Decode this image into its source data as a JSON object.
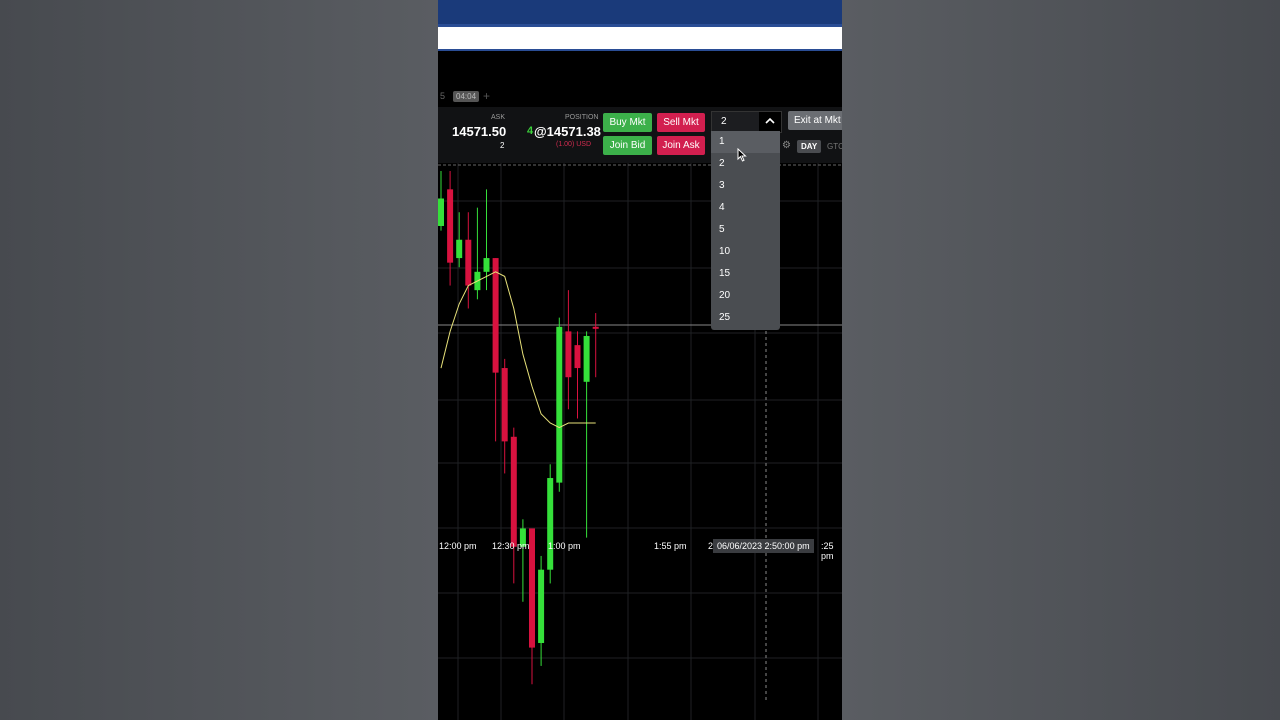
{
  "tab": {
    "label": "5",
    "time": "04:04",
    "plus": "+"
  },
  "orderbar": {
    "ask_label": "ASK",
    "ask_price": "14571.50",
    "ask_size": "2",
    "position_label": "POSITION",
    "position_qty": "4",
    "position_price": "@14571.38",
    "position_pnl": "(1.00) USD",
    "buy_mkt": "Buy Mkt",
    "sell_mkt": "Sell Mkt",
    "join_bid": "Join Bid",
    "join_ask": "Join Ask",
    "exit_mkt": "Exit at Mkt",
    "day": "DAY",
    "gtc": "GTC",
    "gear_icon": "gear-icon"
  },
  "quantity": {
    "selected": "2",
    "toggle_icon": "chevron-up-icon",
    "options": [
      "1",
      "2",
      "3",
      "4",
      "5",
      "10",
      "15",
      "20",
      "25"
    ],
    "hovered": "1"
  },
  "chart_data": {
    "type": "candlestick",
    "x_ticks": [
      "12:00 pm",
      "12:30 pm",
      "1:00 pm",
      "1:55 pm",
      "2",
      ":25 pm"
    ],
    "crosshair_time": "06/06/2023 2:50:00 pm",
    "colors": {
      "up": "#35e03a",
      "down": "#d8123f",
      "ma": "#e8e27a",
      "grid": "#1f2124",
      "crosshair": "#888888"
    },
    "y_range": [
      14490,
      14605
    ],
    "crosshair_price": 14571.4,
    "candles": [
      {
        "dir": "up",
        "o": 14593,
        "h": 14605,
        "l": 14592,
        "c": 14599
      },
      {
        "dir": "down",
        "o": 14601,
        "h": 14605,
        "l": 14580,
        "c": 14585
      },
      {
        "dir": "up",
        "o": 14586,
        "h": 14596,
        "l": 14584,
        "c": 14590
      },
      {
        "dir": "down",
        "o": 14590,
        "h": 14596,
        "l": 14575,
        "c": 14580
      },
      {
        "dir": "up",
        "o": 14579,
        "h": 14597,
        "l": 14577,
        "c": 14583
      },
      {
        "dir": "up",
        "o": 14583,
        "h": 14601,
        "l": 14579,
        "c": 14586
      },
      {
        "dir": "down",
        "o": 14586,
        "h": 14586,
        "l": 14546,
        "c": 14561
      },
      {
        "dir": "down",
        "o": 14562,
        "h": 14564,
        "l": 14539,
        "c": 14546
      },
      {
        "dir": "down",
        "o": 14547,
        "h": 14549,
        "l": 14515,
        "c": 14523
      },
      {
        "dir": "up",
        "o": 14523,
        "h": 14529,
        "l": 14511,
        "c": 14527
      },
      {
        "dir": "down",
        "o": 14527,
        "h": 14527,
        "l": 14493,
        "c": 14501
      },
      {
        "dir": "up",
        "o": 14502,
        "h": 14521,
        "l": 14497,
        "c": 14518
      },
      {
        "dir": "up",
        "o": 14518,
        "h": 14541,
        "l": 14515,
        "c": 14538
      },
      {
        "dir": "up",
        "o": 14537,
        "h": 14573,
        "l": 14535,
        "c": 14571
      },
      {
        "dir": "down",
        "o": 14570,
        "h": 14579,
        "l": 14553,
        "c": 14560
      },
      {
        "dir": "down",
        "o": 14567,
        "h": 14570,
        "l": 14551,
        "c": 14562
      },
      {
        "dir": "up",
        "o": 14559,
        "h": 14570,
        "l": 14525,
        "c": 14569
      },
      {
        "dir": "down",
        "o": 14571,
        "h": 14574,
        "l": 14560,
        "c": 14571
      }
    ],
    "ma_values": [
      14562,
      14570,
      14576,
      14580,
      14581,
      14582,
      14583,
      14582,
      14575,
      14565,
      14558,
      14552,
      14550,
      14549,
      14550,
      14550,
      14550,
      14550
    ]
  }
}
